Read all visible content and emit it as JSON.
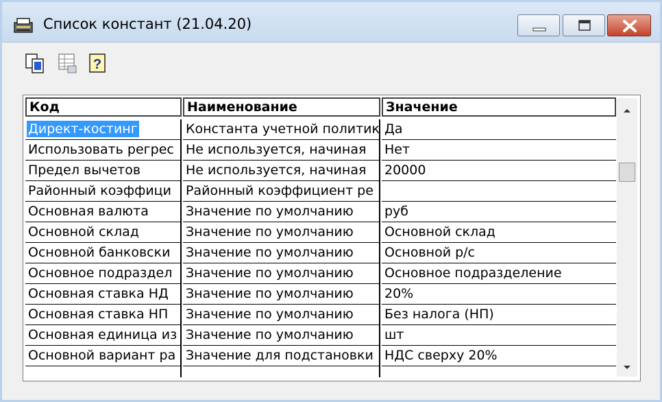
{
  "window": {
    "title": "Список констант (21.04.20)",
    "icon": "ledger-icon",
    "controls": {
      "minimize": "minimize-icon",
      "maximize": "maximize-icon",
      "close": "close-icon"
    }
  },
  "toolbar": {
    "buttons": [
      {
        "icon": "copy-icon"
      },
      {
        "icon": "grid-icon"
      },
      {
        "icon": "help-icon"
      }
    ]
  },
  "table": {
    "columns": [
      "Код",
      "Наименование",
      "Значение"
    ],
    "rows": [
      {
        "code": "Директ-костинг",
        "name": "Константа учетной политик",
        "value": "Да",
        "selected": true
      },
      {
        "code": "Использовать регрес",
        "name": "Не используется, начиная",
        "value": "Нет"
      },
      {
        "code": "Предел вычетов",
        "name": "Не используется, начиная",
        "value": "20000"
      },
      {
        "code": "Районный коэффици",
        "name": "Районный коэффициент ре",
        "value": ""
      },
      {
        "code": "Основная валюта",
        "name": "Значение по умолчанию",
        "value": "руб"
      },
      {
        "code": "Основной склад",
        "name": "Значение по умолчанию",
        "value": "Основной склад"
      },
      {
        "code": "Основной банковски",
        "name": "Значение по умолчанию",
        "value": "Основной р/с"
      },
      {
        "code": "Основное подраздел",
        "name": "Значение по умолчанию",
        "value": "Основное подразделение"
      },
      {
        "code": "Основная ставка НД",
        "name": "Значение по умолчанию",
        "value": "20%"
      },
      {
        "code": "Основная ставка НП",
        "name": "Значение по умолчанию",
        "value": "Без налога (НП)"
      },
      {
        "code": "Основная единица из",
        "name": "Значение по умолчанию",
        "value": "шт"
      },
      {
        "code": "Основной вариант ра",
        "name": "Значение для подстановки",
        "value": "НДС сверху 20%"
      },
      {
        "code": "",
        "name": "",
        "value": ""
      }
    ]
  },
  "colors": {
    "selection": "#3399ff",
    "titlebar": "#c8dbef",
    "close_button": "#c5432b"
  }
}
